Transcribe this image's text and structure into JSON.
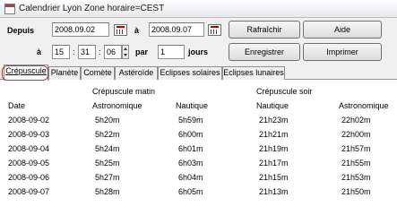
{
  "window": {
    "title": "Calendrier Lyon Zone horaire=CEST"
  },
  "controls": {
    "depuis_label": "Depuis",
    "start_date": "2008.09.02",
    "a_label_1": "à",
    "end_date": "2008.09.07",
    "a_label_2": "à",
    "hour": "15",
    "minute": "31",
    "second": "06",
    "par_label": "par",
    "step": "1",
    "jours_label": "jours",
    "refresh_label": "Rafraîchir",
    "help_label": "Aide",
    "save_label": "Enregistrer",
    "print_label": "Imprimer",
    "colon_1": ":",
    "colon_2": ":"
  },
  "tabs": [
    {
      "label": "Crépuscule",
      "active": true
    },
    {
      "label": "Planète"
    },
    {
      "label": "Comète"
    },
    {
      "label": "Astéroïde"
    },
    {
      "label": "Eclipses solaires"
    },
    {
      "label": "Eclipses lunaires"
    }
  ],
  "table": {
    "group_morning": "Crépuscule matin",
    "group_evening": "Crépuscule soir",
    "columns": [
      "Date",
      "Astronomique",
      "Nautique",
      "Nautique",
      "Astronomique"
    ],
    "rows": [
      [
        "2008-09-02",
        "5h20m",
        "5h59m",
        "21h23m",
        "22h02m"
      ],
      [
        "2008-09-03",
        "5h22m",
        "6h00m",
        "21h21m",
        "22h00m"
      ],
      [
        "2008-09-04",
        "5h24m",
        "6h01m",
        "21h19m",
        "21h57m"
      ],
      [
        "2008-09-05",
        "5h25m",
        "6h03m",
        "21h17m",
        "21h55m"
      ],
      [
        "2008-09-06",
        "5h27m",
        "6h04m",
        "21h15m",
        "21h53m"
      ],
      [
        "2008-09-07",
        "5h28m",
        "6h05m",
        "21h13m",
        "21h50m"
      ]
    ]
  },
  "colors": {
    "highlight": "#c0392b",
    "panel": "#f0f0f0"
  }
}
